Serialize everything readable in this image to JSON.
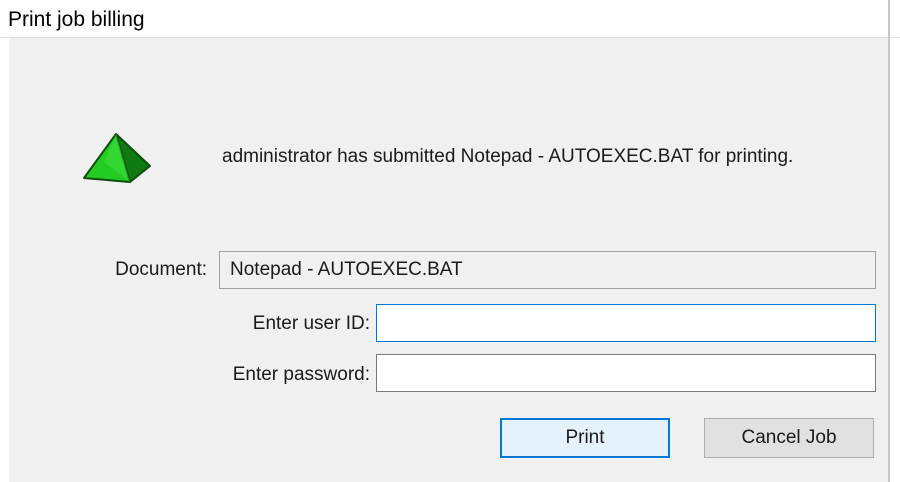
{
  "window": {
    "title": "Print job billing"
  },
  "message": "administrator has submitted Notepad - AUTOEXEC.BAT for printing.",
  "icon": {
    "name": "green-pyramid-icon",
    "colors": {
      "front": "#22cc22",
      "side": "#0f7a0f",
      "edge": "#0b4f0b"
    }
  },
  "form": {
    "document_label": "Document:",
    "document_value": "Notepad - AUTOEXEC.BAT",
    "user_id_label": "Enter user ID:",
    "user_id_value": "",
    "password_label": "Enter password:",
    "password_value": ""
  },
  "buttons": {
    "print": "Print",
    "cancel": "Cancel Job"
  },
  "colors": {
    "focus_accent": "#0078d7",
    "dialog_bg": "#f0f0f0"
  }
}
